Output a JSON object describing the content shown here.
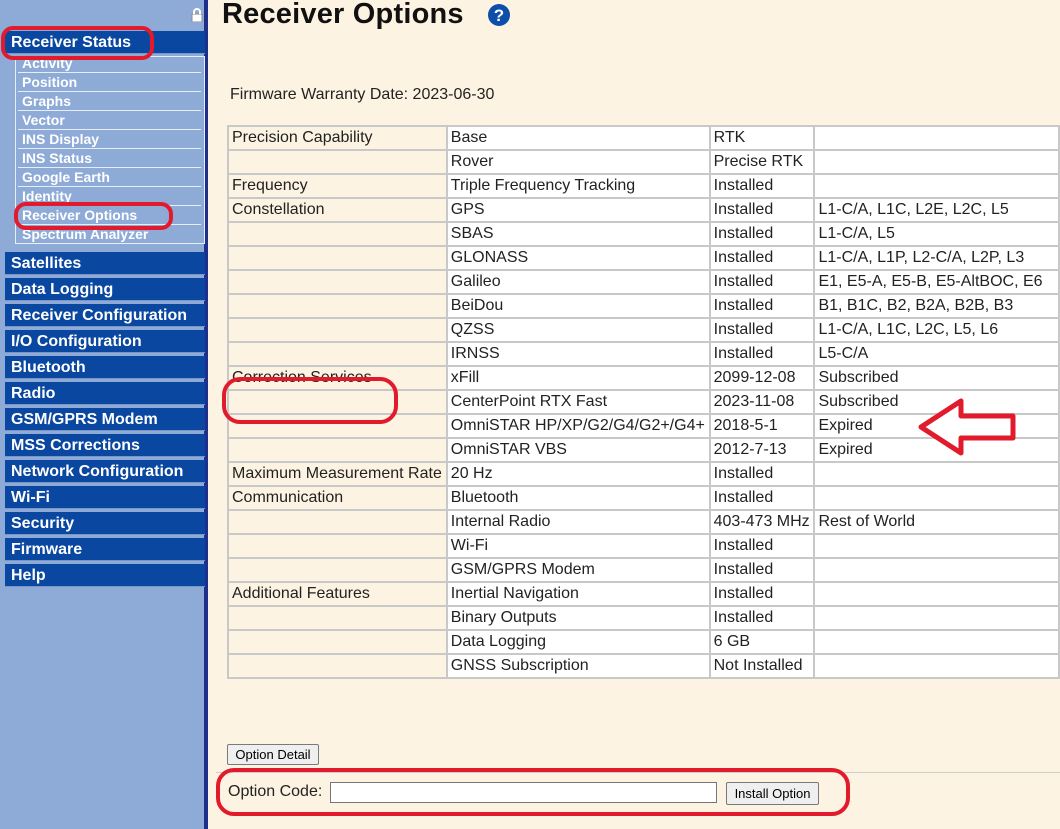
{
  "sidebar": {
    "active_section": "Receiver Status",
    "sub_items": [
      "Activity",
      "Position",
      "Graphs",
      "Vector",
      "INS Display",
      "INS Status",
      "Google Earth",
      "Identity",
      "Receiver Options",
      "Spectrum Analyzer"
    ],
    "main_items": [
      "Satellites",
      "Data Logging",
      "Receiver Configuration",
      "I/O Configuration",
      "Bluetooth",
      "Radio",
      "GSM/GPRS Modem",
      "MSS Corrections",
      "Network Configuration",
      "Wi-Fi",
      "Security",
      "Firmware",
      "Help"
    ]
  },
  "page": {
    "title": "Receiver Options",
    "help_icon": "help-icon",
    "warranty_text": "Firmware Warranty Date: 2023-06-30"
  },
  "table": {
    "rows": [
      [
        "Precision Capability",
        "Base",
        "RTK",
        ""
      ],
      [
        "",
        "Rover",
        "Precise RTK",
        ""
      ],
      [
        "Frequency",
        "Triple Frequency Tracking",
        "Installed",
        ""
      ],
      [
        "Constellation",
        "GPS",
        "Installed",
        "L1-C/A, L1C, L2E, L2C, L5"
      ],
      [
        "",
        "SBAS",
        "Installed",
        "L1-C/A, L5"
      ],
      [
        "",
        "GLONASS",
        "Installed",
        "L1-C/A, L1P, L2-C/A, L2P, L3"
      ],
      [
        "",
        "Galileo",
        "Installed",
        "E1, E5-A, E5-B, E5-AltBOC, E6"
      ],
      [
        "",
        "BeiDou",
        "Installed",
        "B1, B1C, B2, B2A, B2B, B3"
      ],
      [
        "",
        "QZSS",
        "Installed",
        "L1-C/A, L1C, L2C, L5, L6"
      ],
      [
        "",
        "IRNSS",
        "Installed",
        "L5-C/A"
      ],
      [
        "Correction Services",
        "xFill",
        "2099-12-08",
        "Subscribed"
      ],
      [
        "",
        "CenterPoint RTX Fast",
        "2023-11-08",
        "Subscribed"
      ],
      [
        "",
        "OmniSTAR HP/XP/G2/G4/G2+/G4+",
        "2018-5-1",
        "Expired"
      ],
      [
        "",
        "OmniSTAR VBS",
        "2012-7-13",
        "Expired"
      ],
      [
        "Maximum Measurement Rate",
        "20 Hz",
        "Installed",
        ""
      ],
      [
        "Communication",
        "Bluetooth",
        "Installed",
        ""
      ],
      [
        "",
        "Internal Radio",
        "403-473 MHz",
        "Rest of World"
      ],
      [
        "",
        "Wi-Fi",
        "Installed",
        ""
      ],
      [
        "",
        "GSM/GPRS Modem",
        "Installed",
        ""
      ],
      [
        "Additional Features",
        "Inertial Navigation",
        "Installed",
        ""
      ],
      [
        "",
        "Binary Outputs",
        "Installed",
        ""
      ],
      [
        "",
        "Data Logging",
        "6 GB",
        ""
      ],
      [
        "",
        "GNSS Subscription",
        "Not Installed",
        ""
      ]
    ]
  },
  "buttons": {
    "option_detail": "Option Detail",
    "install_option": "Install Option"
  },
  "option_code": {
    "label": "Option Code:",
    "value": ""
  },
  "colors": {
    "nav_blue": "#0a47a0",
    "sidebar_bg": "#8eaad6",
    "page_bg": "#fdf3e2",
    "annotation_red": "#e21b2c"
  }
}
